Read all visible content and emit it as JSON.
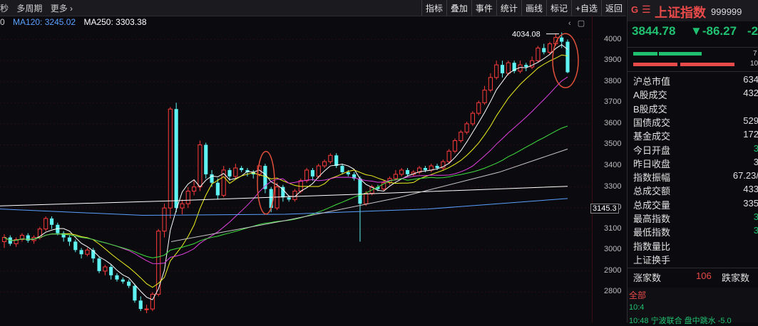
{
  "toolbar": {
    "left_items": [
      "秒",
      "多周期",
      "更多 ›"
    ],
    "buttons": [
      "指标",
      "叠加",
      "事件",
      "统计",
      "画线",
      "标记",
      "+自选",
      "返回"
    ]
  },
  "ma_legend": {
    "ma120": "MA120: 3245.02",
    "ma250": "MA250: 3303.38",
    "colors": {
      "ma5": "#ffffff",
      "ma10": "#f0f020",
      "ma20": "#e040e0",
      "ma60": "#40e040",
      "ma120": "#5aa0ff",
      "ma250": "#ffffff"
    }
  },
  "chart_data": {
    "type": "candlestick",
    "ylim": [
      2700,
      4080
    ],
    "yticks": [
      2800,
      2900,
      3000,
      3100,
      3200,
      3300,
      3400,
      3500,
      3600,
      3700,
      3800,
      3900,
      4000
    ],
    "high_label": "4034.08",
    "current_price": "3145.3",
    "up_color": "#ff3b3b",
    "down_color": "#5ef2f2",
    "candles": [
      [
        3040,
        3060,
        3010,
        3075
      ],
      [
        3060,
        3030,
        3020,
        3070
      ],
      [
        3030,
        3050,
        3015,
        3060
      ],
      [
        3050,
        3070,
        3040,
        3080
      ],
      [
        3070,
        3045,
        3035,
        3080
      ],
      [
        3045,
        3060,
        3030,
        3070
      ],
      [
        3060,
        3100,
        3050,
        3110
      ],
      [
        3100,
        3150,
        3090,
        3160
      ],
      [
        3150,
        3120,
        3100,
        3160
      ],
      [
        3120,
        3080,
        3070,
        3130
      ],
      [
        3080,
        3060,
        3040,
        3090
      ],
      [
        3060,
        3040,
        3020,
        3070
      ],
      [
        3040,
        3000,
        2990,
        3050
      ],
      [
        3000,
        2980,
        2960,
        3010
      ],
      [
        2980,
        3000,
        2970,
        3010
      ],
      [
        3000,
        2960,
        2940,
        3010
      ],
      [
        2960,
        2900,
        2890,
        2970
      ],
      [
        2900,
        2920,
        2880,
        2930
      ],
      [
        2920,
        2880,
        2860,
        2930
      ],
      [
        2880,
        2860,
        2850,
        2890
      ],
      [
        2860,
        2850,
        2840,
        2870
      ],
      [
        2850,
        2830,
        2820,
        2860
      ],
      [
        2830,
        2760,
        2750,
        2840
      ],
      [
        2760,
        2720,
        2710,
        2780
      ],
      [
        2720,
        2720,
        2700,
        2740
      ],
      [
        2720,
        2790,
        2710,
        2800
      ],
      [
        2790,
        3090,
        2780,
        3100
      ],
      [
        3090,
        3200,
        3060,
        3220
      ],
      [
        3200,
        3670,
        3150,
        3680
      ],
      [
        3670,
        3200,
        3180,
        3700
      ],
      [
        3200,
        3220,
        3170,
        3240
      ],
      [
        3220,
        3280,
        3200,
        3300
      ],
      [
        3280,
        3300,
        3260,
        3330
      ],
      [
        3300,
        3500,
        3280,
        3520
      ],
      [
        3500,
        3360,
        3340,
        3510
      ],
      [
        3360,
        3320,
        3300,
        3380
      ],
      [
        3320,
        3260,
        3240,
        3340
      ],
      [
        3260,
        3380,
        3250,
        3400
      ],
      [
        3380,
        3350,
        3330,
        3390
      ],
      [
        3350,
        3390,
        3340,
        3410
      ],
      [
        3390,
        3380,
        3370,
        3400
      ],
      [
        3380,
        3370,
        3350,
        3390
      ],
      [
        3370,
        3360,
        3340,
        3380
      ],
      [
        3360,
        3400,
        3350,
        3420
      ],
      [
        3400,
        3290,
        3270,
        3410
      ],
      [
        3290,
        3200,
        3180,
        3300
      ],
      [
        3200,
        3300,
        3190,
        3320
      ],
      [
        3300,
        3250,
        3230,
        3310
      ],
      [
        3250,
        3240,
        3230,
        3260
      ],
      [
        3240,
        3280,
        3230,
        3290
      ],
      [
        3280,
        3330,
        3270,
        3340
      ],
      [
        3330,
        3380,
        3320,
        3390
      ],
      [
        3380,
        3350,
        3330,
        3390
      ],
      [
        3350,
        3400,
        3340,
        3410
      ],
      [
        3400,
        3420,
        3390,
        3430
      ],
      [
        3420,
        3450,
        3410,
        3460
      ],
      [
        3450,
        3400,
        3390,
        3460
      ],
      [
        3400,
        3370,
        3360,
        3410
      ],
      [
        3370,
        3360,
        3350,
        3380
      ],
      [
        3360,
        3340,
        3330,
        3370
      ],
      [
        3340,
        3220,
        3040,
        3350
      ],
      [
        3220,
        3270,
        3210,
        3280
      ],
      [
        3270,
        3300,
        3260,
        3310
      ],
      [
        3300,
        3290,
        3280,
        3310
      ],
      [
        3290,
        3320,
        3280,
        3330
      ],
      [
        3320,
        3340,
        3310,
        3350
      ],
      [
        3340,
        3360,
        3330,
        3380
      ],
      [
        3360,
        3380,
        3350,
        3390
      ],
      [
        3380,
        3360,
        3350,
        3390
      ],
      [
        3360,
        3370,
        3350,
        3380
      ],
      [
        3370,
        3390,
        3360,
        3400
      ],
      [
        3390,
        3380,
        3370,
        3400
      ],
      [
        3380,
        3400,
        3370,
        3410
      ],
      [
        3400,
        3390,
        3380,
        3410
      ],
      [
        3390,
        3420,
        3380,
        3430
      ],
      [
        3420,
        3470,
        3410,
        3480
      ],
      [
        3470,
        3520,
        3460,
        3530
      ],
      [
        3520,
        3560,
        3510,
        3570
      ],
      [
        3560,
        3600,
        3550,
        3610
      ],
      [
        3600,
        3650,
        3590,
        3660
      ],
      [
        3650,
        3700,
        3640,
        3710
      ],
      [
        3700,
        3760,
        3690,
        3780
      ],
      [
        3760,
        3820,
        3750,
        3840
      ],
      [
        3820,
        3880,
        3810,
        3900
      ],
      [
        3880,
        3840,
        3820,
        3900
      ],
      [
        3840,
        3890,
        3830,
        3900
      ],
      [
        3890,
        3850,
        3840,
        3900
      ],
      [
        3850,
        3880,
        3840,
        3900
      ],
      [
        3880,
        3870,
        3850,
        3890
      ],
      [
        3870,
        3900,
        3860,
        3920
      ],
      [
        3900,
        3960,
        3890,
        3970
      ],
      [
        3960,
        3940,
        3930,
        3980
      ],
      [
        3940,
        3980,
        3930,
        3990
      ],
      [
        3980,
        4010,
        3970,
        4030
      ],
      [
        4010,
        3990,
        3960,
        4034
      ],
      [
        3990,
        3845,
        3840,
        4000
      ]
    ]
  },
  "panel": {
    "title": "上证指数",
    "code": "999999",
    "price": "3844.78",
    "change": "▼-86.27",
    "change_pct": "-2",
    "rows": [
      {
        "label": "沪总市值",
        "value": "634",
        "green": false
      },
      {
        "label": "A股成交",
        "value": "432",
        "green": false
      },
      {
        "label": "B股成交",
        "value": "",
        "green": false
      },
      {
        "label": "国债成交",
        "value": "529",
        "green": false
      },
      {
        "label": "基金成交",
        "value": "172",
        "green": false
      },
      {
        "label": "今日开盘",
        "value": "3",
        "green": true
      },
      {
        "label": "昨日收盘",
        "value": "3",
        "green": false
      },
      {
        "label": "指数振幅",
        "value": "67.23/",
        "green": false
      },
      {
        "label": "总成交额",
        "value": "433",
        "green": false
      },
      {
        "label": "总成交量",
        "value": "335",
        "green": false
      },
      {
        "label": "最高指数",
        "value": "3",
        "green": true
      },
      {
        "label": "最低指数",
        "value": "3",
        "green": true
      },
      {
        "label": "指数量比",
        "value": "",
        "green": false
      },
      {
        "label": "上证换手",
        "value": "",
        "green": false
      }
    ],
    "rise_label": "涨家数",
    "rise_value": "106",
    "fall_label": "跌家数",
    "news_tab": "全部",
    "news1": "10:4",
    "news2": "10:48  宁波联合  盘中跳水  -5.0"
  }
}
